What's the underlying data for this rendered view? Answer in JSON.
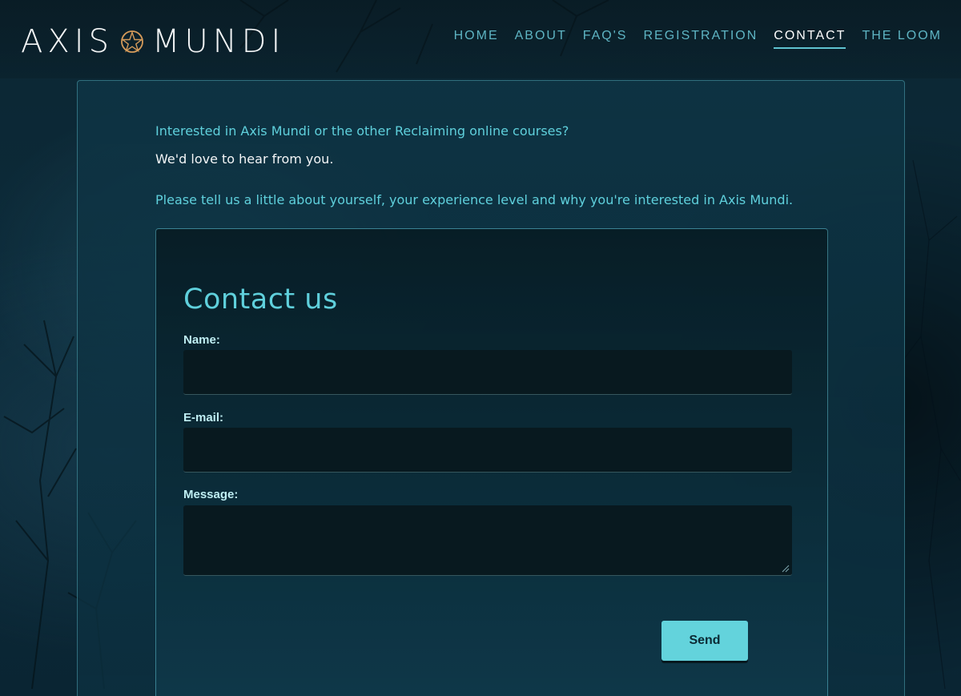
{
  "brand": {
    "logo_left": "AXIS",
    "logo_right": "MUNDI",
    "logo_icon": "pentacle-icon"
  },
  "nav": {
    "items": [
      {
        "label": "HOME",
        "active": false
      },
      {
        "label": "ABOUT",
        "active": false
      },
      {
        "label": "FAQ'S",
        "active": false
      },
      {
        "label": "REGISTRATION",
        "active": false
      },
      {
        "label": "CONTACT",
        "active": true
      },
      {
        "label": "THE LOOM",
        "active": false
      }
    ]
  },
  "intro": {
    "line1": "Interested in Axis Mundi or the other Reclaiming online courses?",
    "line2": "We'd love to hear from you.",
    "line3": "Please tell us a little about yourself, your experience level and why you're interested in Axis Mundi."
  },
  "form": {
    "title": "Contact us",
    "name_label": "Name:",
    "name_value": "",
    "email_label": "E-mail:",
    "email_value": "",
    "message_label": "Message:",
    "message_value": "",
    "send_label": "Send"
  },
  "colors": {
    "accent": "#5fd0dc",
    "button": "#63d3dc",
    "logo_star": "#d49a5a",
    "background": "#0b2a39"
  }
}
